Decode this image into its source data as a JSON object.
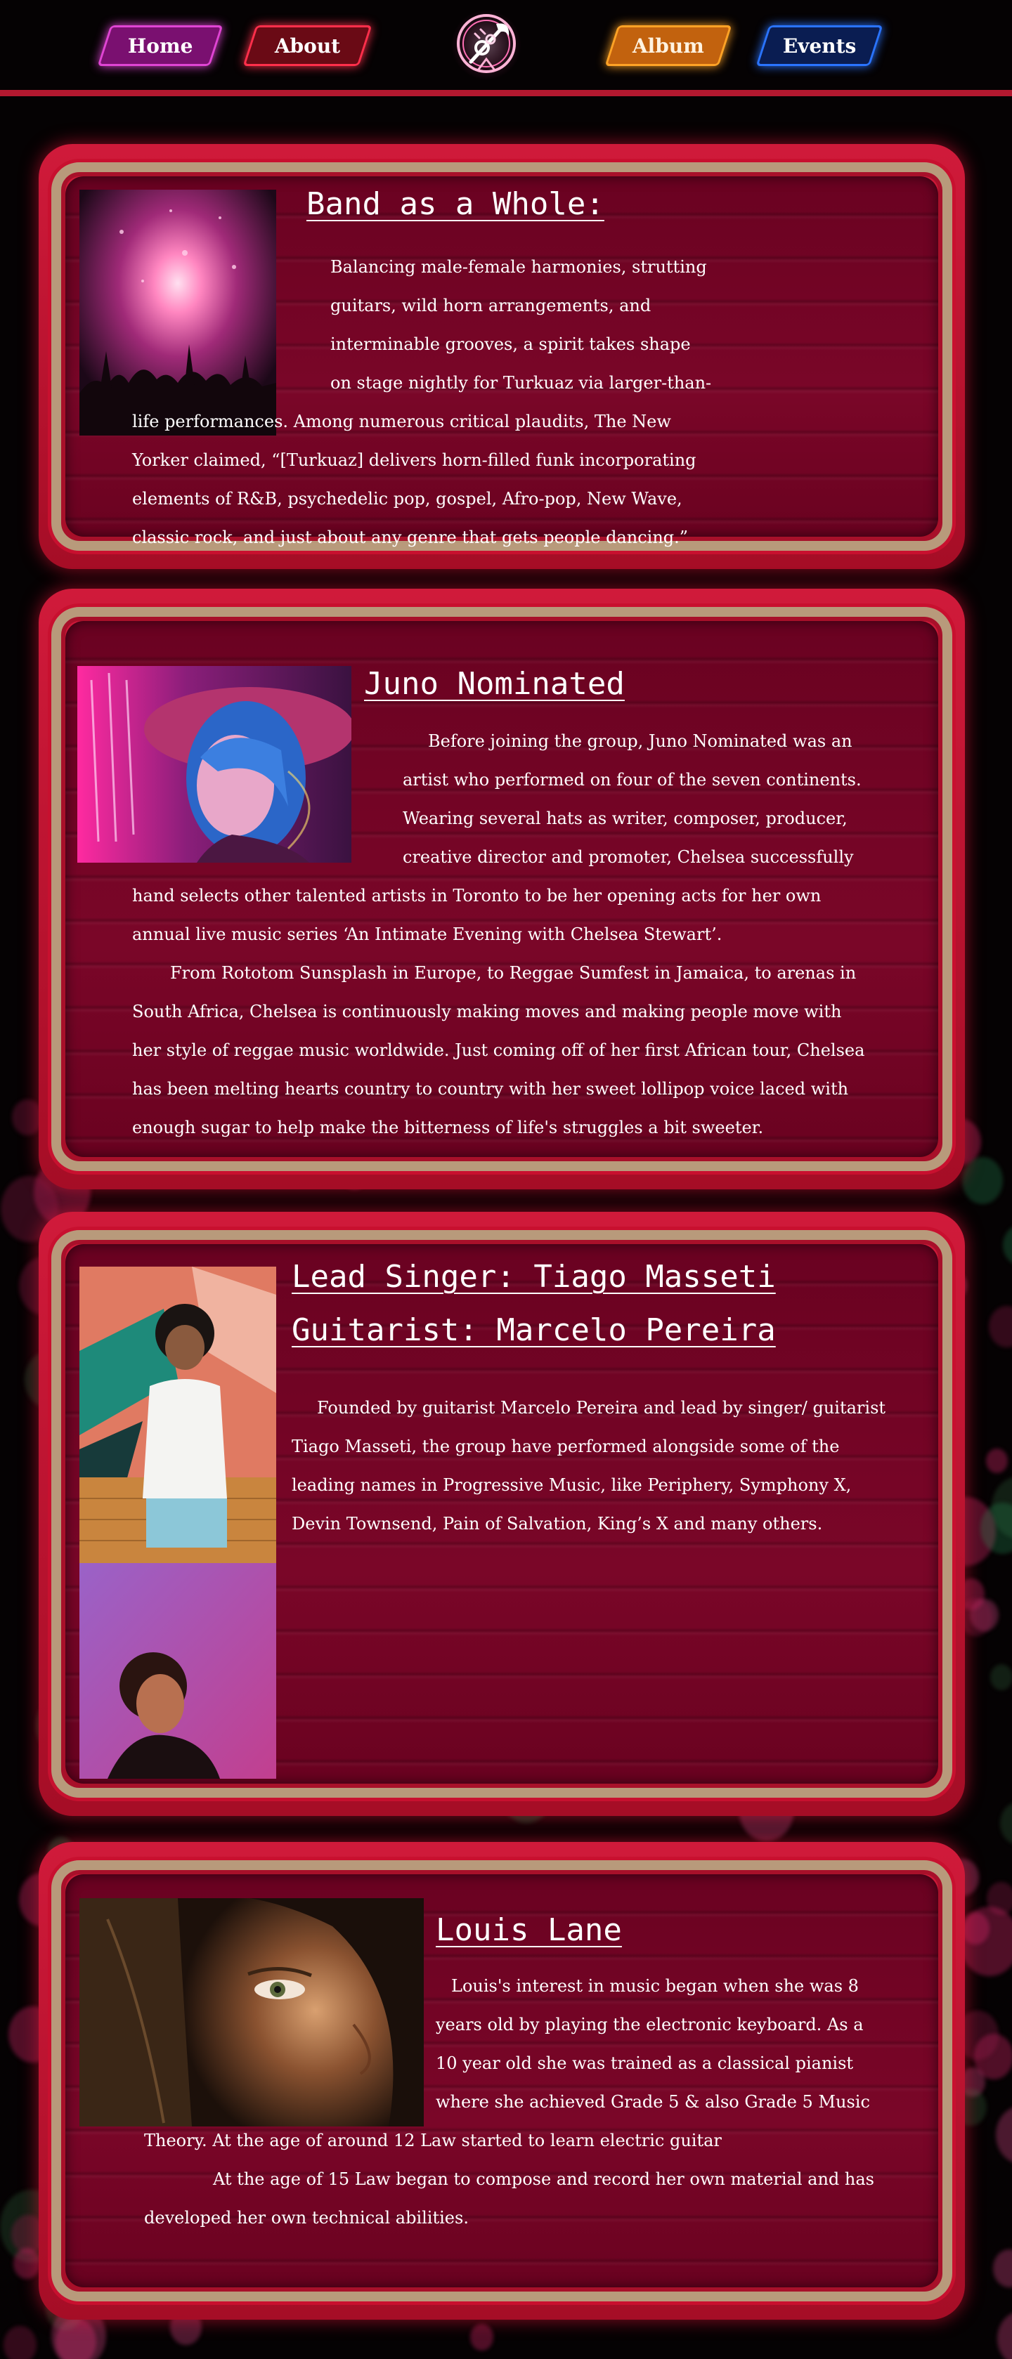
{
  "nav": {
    "home_label": "Home",
    "about_label": "About",
    "album_label": "Album",
    "events_label": "Events",
    "logo_icon": "trumpet-logo-icon"
  },
  "colors": {
    "nav_rule": "#b3182f",
    "card_frame": "#c8102f",
    "card_gold": "#b89a7b",
    "card_inner": "#6f0424",
    "home": "#e045d4",
    "about": "#ff2f4b",
    "album": "#ffa326",
    "events": "#2a74ff"
  },
  "sections": [
    {
      "title": "Band as a Whole:",
      "image": "concert-crowd-photo",
      "paragraphs": [
        "Balancing male-female harmonies, strutting guitars, wild horn arrangements, and interminable grooves, a spirit takes shape on stage nightly for Turkuaz via larger-than-life performances. Among numerous critical plaudits, The New Yorker claimed, “[Turkuaz] delivers horn-filled funk incorporating elements of R&B, psychedelic pop, gospel, Afro-pop, New Wave, classic rock, and just about any genre that gets people dancing.”"
      ]
    },
    {
      "title": "Juno Nominated",
      "image": "woman-blue-hair-portrait",
      "paragraphs": [
        "Before joining the group, Juno Nominated was an artist who performed on four of the seven continents. Wearing several hats as writer, composer, producer, creative director and promoter, Chelsea successfully hand selects other talented artists in Toronto to be her opening acts for her own annual live music series ‘An Intimate Evening with Chelsea Stewart’.",
        "From Rototom Sunsplash in Europe, to Reggae Sumfest in Jamaica, to arenas in South Africa, Chelsea is continuously making moves and making people move with her style of reggae music worldwide. Just coming off of her first African tour, Chelsea has been melting hearts country to country with her sweet lollipop voice laced with enough sugar to help make the bitterness of life's struggles a bit sweeter."
      ]
    },
    {
      "title_line1": "Lead Singer: Tiago Masseti",
      "title_line2": "Guitarist: Marcelo Pereira",
      "image_top": "singer-graffiti-wall-photo",
      "image_bottom": "guitarist-looking-up-photo",
      "paragraphs": [
        "Founded by guitarist Marcelo Pereira and lead by singer/ guitarist Tiago Masseti, the group have performed alongside some of the leading names in Progressive Music, like Periphery, Symphony X, Devin Townsend, Pain of Salvation, King’s X and many others."
      ]
    },
    {
      "title": "Louis Lane",
      "image": "woman-face-closeup-photo",
      "paragraphs": [
        "Louis's interest in music began when she was 8 years old by playing the electronic keyboard. As a 10 year old she was trained as a classical pianist where she achieved Grade 5 & also Grade 5 Music Theory. At the age of around 12 Law started to learn electric guitar",
        "At the age of 15 Law began to compose and record her own material and has developed her own technical abilities."
      ]
    }
  ]
}
